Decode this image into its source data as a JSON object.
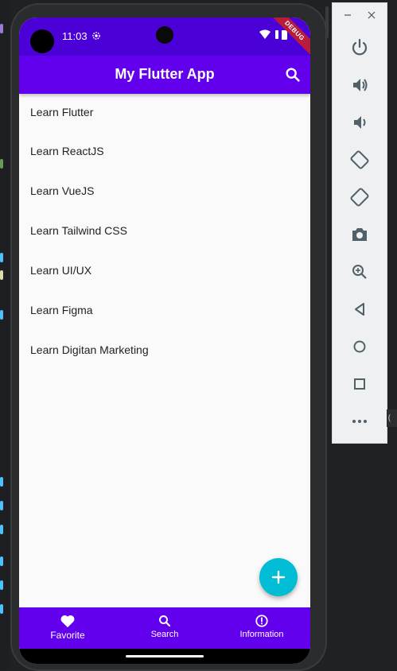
{
  "status_bar": {
    "time": "11:03",
    "debug_label": "DEBUG"
  },
  "app_bar": {
    "title": "My Flutter App"
  },
  "list": {
    "items": [
      "Learn Flutter",
      "Learn ReactJS",
      "Learn VueJS",
      "Learn Tailwind CSS",
      "Learn UI/UX",
      "Learn Figma",
      "Learn Digitan Marketing"
    ]
  },
  "bottom_nav": {
    "items": [
      {
        "label": "Favorite",
        "icon": "heart-icon",
        "active": true
      },
      {
        "label": "Search",
        "icon": "search-icon",
        "active": false
      },
      {
        "label": "Information",
        "icon": "info-icon",
        "active": false
      }
    ]
  },
  "emulator_panel": {
    "buttons": [
      "power-icon",
      "volume-up-icon",
      "volume-down-icon",
      "rotate-left-icon",
      "rotate-right-icon",
      "camera-icon",
      "zoom-in-icon",
      "back-icon",
      "home-icon",
      "overview-icon",
      "more-icon"
    ]
  },
  "overflow_tag": {
    "text": "("
  },
  "colors": {
    "status_bar": "#4a00d6",
    "app_bar": "#6200ee",
    "bottom_nav": "#6200ee",
    "fab": "#00bcd4",
    "debug_ribbon": "#b71c3a"
  }
}
